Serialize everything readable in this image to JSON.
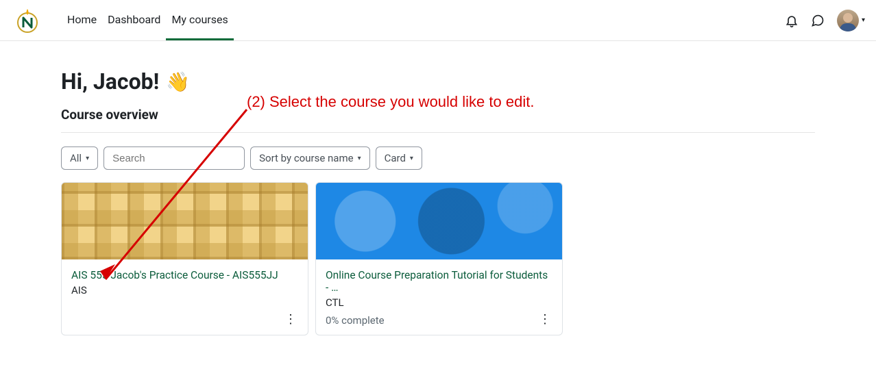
{
  "nav": {
    "items": [
      {
        "label": "Home",
        "active": false
      },
      {
        "label": "Dashboard",
        "active": false
      },
      {
        "label": "My courses",
        "active": true
      }
    ]
  },
  "greeting": "Hi, Jacob!",
  "wave_emoji": "👋",
  "section_title": "Course overview",
  "controls": {
    "filter_label": "All",
    "search_placeholder": "Search",
    "sort_label": "Sort by course name",
    "view_label": "Card"
  },
  "courses": [
    {
      "title": "AIS 555 Jacob's Practice Course - AIS555JJ",
      "category": "AIS",
      "progress": "",
      "pattern": "plaid"
    },
    {
      "title": "Online Course Preparation Tutorial for Students - …",
      "category": "CTL",
      "progress": "0% complete",
      "pattern": "hex"
    }
  ],
  "annotation_text": "(2) Select the course you would like to edit.",
  "icons": {
    "bell": "bell-icon",
    "chat": "chat-icon",
    "kebab": "⋮"
  }
}
